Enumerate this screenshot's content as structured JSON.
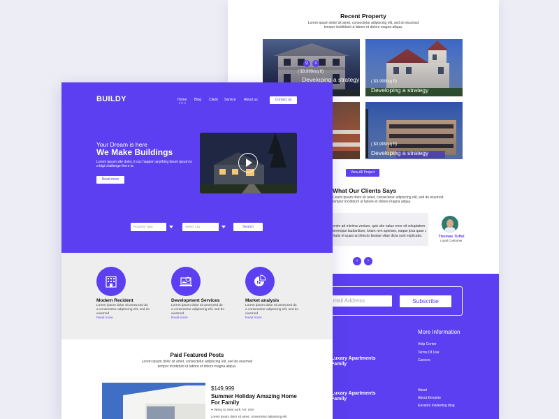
{
  "back_page": {
    "recent_title": "Recent Property",
    "recent_desc_1": "Lorem ipsum dolor sit amet, consectetur adipiscing elit, sed do eiusmod",
    "recent_desc_2": "tempor incididunt ut labore et dolore magna aliqua.",
    "tiles": [
      {
        "price": "( $3,999/sq ft)",
        "title": "Developing a strategy"
      },
      {
        "price": "( $3,999/sq ft)",
        "title": "Developing a strategy"
      },
      {
        "price": "( $3,999/sq ft)",
        "title": "Developing a strategy"
      }
    ],
    "view_all_label": "View All Project",
    "clients_title": "What Our Clients Says",
    "clients_desc_1": "Lorem ipsum dolor sit amet, consectetur adipiscing elit, sed do eiusmod",
    "clients_desc_2": "tempor incididunt ut labore et dolore magna aliqua.",
    "testimonial_lines": [
      "Ut enim ad minima veniam, quis site natus error sit voluptatem accusantium",
      "doloremque laudantium, totam rem aperiam, eaque ipsa quae ab illo inventore",
      "veritatis et quasi architecto beatae vitae dicta sunt explicabo."
    ],
    "testimonial_name": "Thomas Tuffel",
    "testimonial_role": "Loyal Customer",
    "prev_arrow": "‹",
    "next_arrow": "›",
    "subscribe_placeholder": "Email Address",
    "subscribe_label": "Subscribe",
    "more_info_title": "More Information",
    "more_info_links": [
      "Help Center",
      "Terms Of Use",
      "Careers"
    ],
    "about_links": [
      "About",
      "About Envanto",
      "Envanto marketing blog"
    ],
    "footer_posts": [
      "Luxary Apartments Family",
      "Luxary Apartments Family"
    ]
  },
  "front_page": {
    "logo": "BUILDY",
    "nav": [
      "Home",
      "Blog",
      "Client",
      "Service",
      "About us"
    ],
    "contact_label": "Contact us",
    "tagline": "Your Dream is here",
    "headline": "We Make Buildings",
    "hero_desc": "Lorem ipsum site dolor, it coz happen anything lorum ipsum is a bigi challenge there is.",
    "read_more_label": "Read more",
    "property_type_placeholder": "Property Type",
    "select_city_placeholder": "Select City",
    "search_label": "Search",
    "services": [
      {
        "name": "Modern Recident",
        "desc": "Lorem ipsum dolor sit amet,sed do a consectetur adipiscing elit, sed do eiusmod",
        "more": "Read more",
        "icon": "building-icon"
      },
      {
        "name": "Development Services",
        "desc": "Lorem ipsum dolor sit amet,sed do a consectetur adipiscing elit, sed do eiusmod",
        "more": "Read more",
        "icon": "laptop-icon"
      },
      {
        "name": "Market analysis",
        "desc": "Lorem ipsum dolor sit amet,sed do a consectetur adipiscing elit, sed do eiusmod",
        "more": "Read more",
        "icon": "pie-chart-icon"
      }
    ],
    "paid_title": "Paid Featured Posts",
    "paid_desc_1": "Lorem ipsum dolor sit amet, consectetur adipiscing elit, sed do eiusmod",
    "paid_desc_2": "tempor incididunt ut labore et dolore magna aliqua.",
    "featured": {
      "price": "$149,999",
      "title": "Summer Holiday Amazing Home For Family",
      "location": "Vessy st, New york, NY, USA",
      "desc": "Lorem ipsum dolor sit amet, consectetur adipiscing elit"
    }
  },
  "colors": {
    "accent": "#5b3ff0",
    "background": "#ededf5",
    "services_bg": "#eeeeee"
  }
}
